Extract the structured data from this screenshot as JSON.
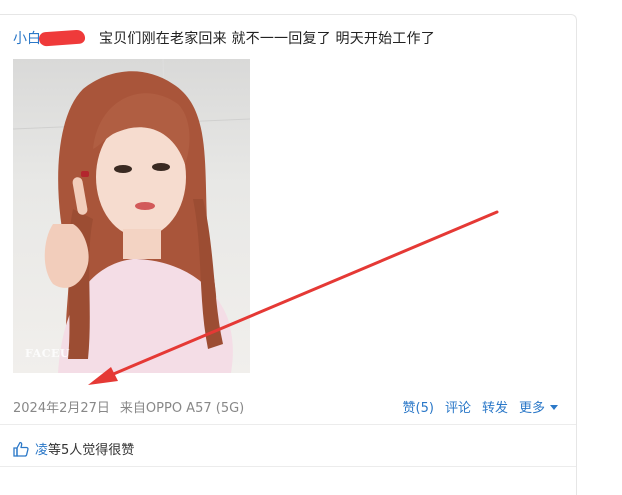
{
  "post": {
    "author": "小白",
    "text": "宝贝们刚在老家回来 就不一一回复了 明天开始工作了",
    "photo_watermark": "FACEU",
    "date": "2024年2月27日",
    "source": "来自OPPO A57 (5G)"
  },
  "actions": {
    "like": "赞(5)",
    "comment": "评论",
    "forward": "转发",
    "more": "更多"
  },
  "likes": {
    "user": "凌",
    "count_text": "等5人觉得很赞"
  },
  "colors": {
    "link": "#2b78c8",
    "annotation_arrow": "#e53935",
    "redaction": "#ef3a3a"
  }
}
